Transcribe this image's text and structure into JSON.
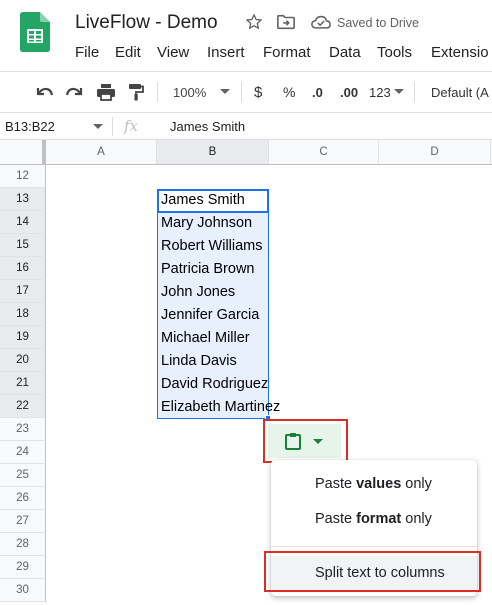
{
  "header": {
    "title": "LiveFlow - Demo",
    "save_status": "Saved to Drive"
  },
  "menu": [
    "File",
    "Edit",
    "View",
    "Insert",
    "Format",
    "Data",
    "Tools",
    "Extensio"
  ],
  "toolbar": {
    "zoom": "100%",
    "currency": "$",
    "percent": "%",
    "dec_decrease": ".0",
    "dec_increase": ".00",
    "more_formats": "123",
    "font": "Default (A"
  },
  "formula_bar": {
    "name_box": "B13:B22",
    "fx": "fx",
    "value": "James Smith"
  },
  "columns": [
    "A",
    "B",
    "C",
    "D"
  ],
  "rows": [
    "12",
    "13",
    "14",
    "15",
    "16",
    "17",
    "18",
    "19",
    "20",
    "21",
    "22",
    "23",
    "24",
    "25",
    "26",
    "27",
    "28",
    "29",
    "30"
  ],
  "cells_b": [
    "James Smith",
    "Mary Johnson",
    "Robert Williams",
    "Patricia Brown",
    "John Jones",
    "Jennifer Garcia",
    "Michael Miller",
    "Linda Davis",
    "David Rodriguez",
    "Elizabeth Martinez"
  ],
  "paste_menu": {
    "item1_prefix": "Paste ",
    "item1_bold": "values",
    "item1_suffix": " only",
    "item2_prefix": "Paste ",
    "item2_bold": "format",
    "item2_suffix": " only",
    "item3": "Split text to columns"
  },
  "colors": {
    "accent": "#1a73e8",
    "selection_fill": "#e8f0fe",
    "highlight_outline": "#d93025",
    "paste_green": "#188038"
  }
}
